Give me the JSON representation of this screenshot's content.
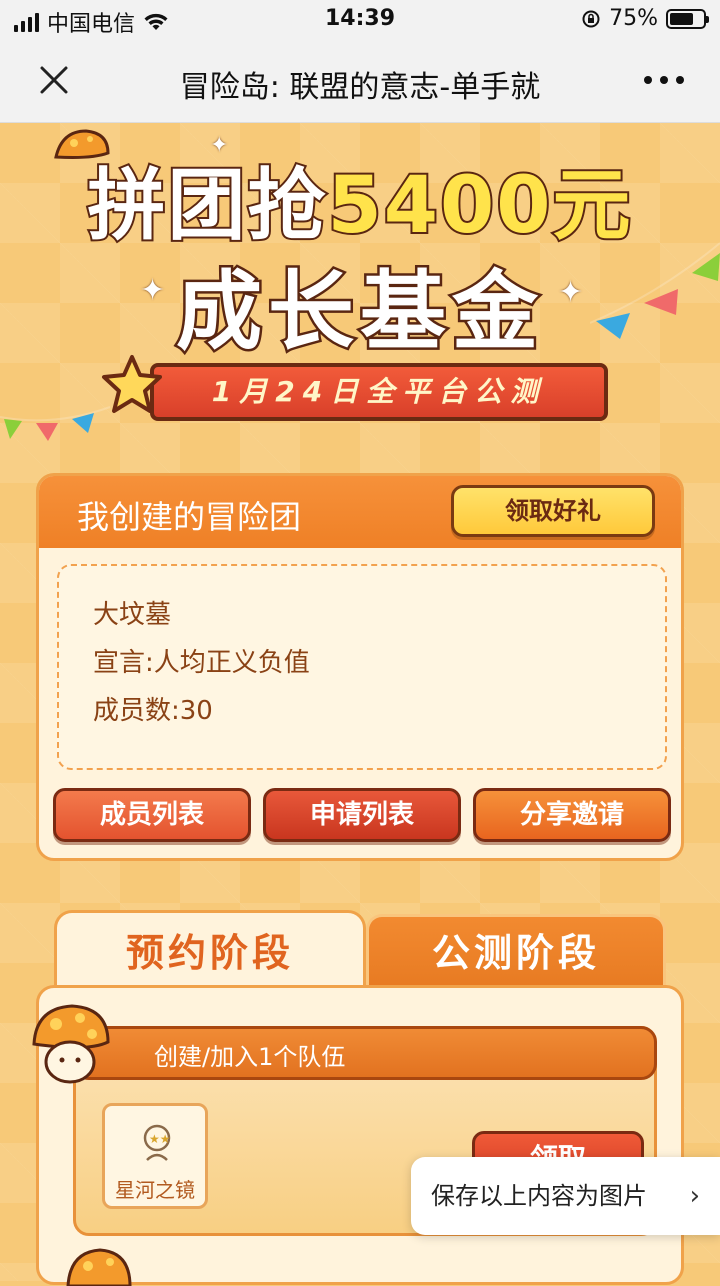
{
  "status_bar": {
    "carrier": "中国电信",
    "time": "14:39",
    "battery_pct": "75%",
    "battery_level": 0.75
  },
  "nav": {
    "title": "冒险岛: 联盟的意志-单手就",
    "close_icon": "close-icon",
    "more_icon": "more-icon"
  },
  "hero": {
    "line1_pre": "拼团抢",
    "line1_amount": "5400元",
    "line2": "成长基金",
    "ribbon": "1月24日全平台公测"
  },
  "team": {
    "title": "我创建的冒险团",
    "gift_button": "领取好礼",
    "name": "大坟墓",
    "declaration": "宣言:人均正义负值",
    "members": "成员数:30",
    "buttons": {
      "members": "成员列表",
      "applications": "申请列表",
      "invite": "分享邀请"
    }
  },
  "stages": {
    "tabs": [
      {
        "label": "预约阶段",
        "active": true
      },
      {
        "label": "公测阶段",
        "active": false
      }
    ]
  },
  "tasks": {
    "items": [
      {
        "label": "创建/加入1个队伍",
        "reward": "星河之镜",
        "claim": "领取"
      }
    ]
  },
  "overlay": {
    "save": "保存以上内容为图片",
    "chevron": "›"
  },
  "colors": {
    "accent_orange": "#ef8026",
    "background": "#f7c978",
    "button_red": "#d13c22",
    "gift_yellow": "#ffc93a"
  }
}
